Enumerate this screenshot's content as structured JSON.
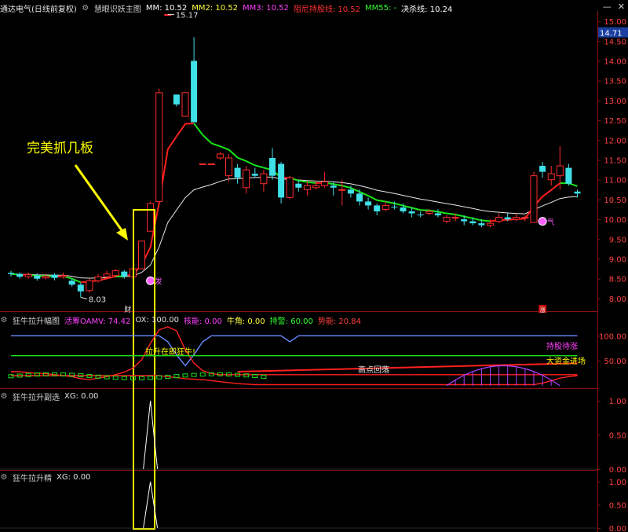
{
  "colors": {
    "bg": "#000000",
    "axis": "#8a1010",
    "up": "#ff2b2b",
    "down": "#3fe0e8",
    "ma_red": "#ff2020",
    "ma_green": "#19e619",
    "ma_white": "#e8e8e8",
    "annotation": "#ffff00",
    "magenta": "#ff40ff",
    "purple": "#b040ff",
    "blue_line": "#6a8cff"
  },
  "main_panel": {
    "title": "通达电气(日线前复权)",
    "indicator": "慧眼识妖主图",
    "mm_label": "MM: 10.52",
    "mm2_label": "MM2: 10.52",
    "mm3_label": "MM3: 10.52",
    "hold_label": "阻尼持股线: 10.52",
    "mm55_label": "MM55: -",
    "decision_label": "决杀线: 10.24",
    "current_price": "14.71",
    "high_label": "15.17",
    "low_label": "8.03",
    "annotation_text": "完美抓几板",
    "marker_fa": "发",
    "marker_qi": "气",
    "marker_cai": "财",
    "marker_zhang": "涨"
  },
  "sub1": {
    "title": "狂牛拉升幅图",
    "oamv_label": "活筹OAMV: 74.42",
    "ox_label": "OX: 100.00",
    "power_label": "核能: 0.00",
    "bull_label": "牛角: 0.00",
    "hold_label": "持警: 60.00",
    "momentum_label": "势能: 20.84",
    "text_launch": "拉升在即狂牛!",
    "text_high": "高点回落",
    "text_hold": "持股待涨",
    "text_capital": "大资金进场"
  },
  "sub2": {
    "title": "狂牛拉升副选",
    "xg_label": "XG: 0.00"
  },
  "sub3": {
    "title": "狂牛拉升精",
    "xg_label": "XG: 0.00"
  },
  "window_controls": [
    "—",
    "✕"
  ],
  "chart_data": [
    {
      "type": "candlestick",
      "title": "通达电气(日线前复权)",
      "y_ticks": [
        8.0,
        8.5,
        9.0,
        9.5,
        10.0,
        10.5,
        11.0,
        11.5,
        12.0,
        12.5,
        13.0,
        13.5,
        14.0,
        14.5,
        15.0
      ],
      "ylim": [
        7.72,
        15.22
      ],
      "candles": [
        [
          8.65,
          8.62,
          8.7,
          8.55
        ],
        [
          8.62,
          8.55,
          8.66,
          8.5
        ],
        [
          8.55,
          8.6,
          8.66,
          8.5
        ],
        [
          8.58,
          8.5,
          8.64,
          8.45
        ],
        [
          8.52,
          8.56,
          8.62,
          8.48
        ],
        [
          8.6,
          8.52,
          8.64,
          8.46
        ],
        [
          8.55,
          8.58,
          8.66,
          8.5
        ],
        [
          8.45,
          8.35,
          8.5,
          8.3
        ],
        [
          8.35,
          8.18,
          8.4,
          8.03
        ],
        [
          8.2,
          8.45,
          8.5,
          8.15
        ],
        [
          8.45,
          8.55,
          8.62,
          8.4
        ],
        [
          8.55,
          8.62,
          8.7,
          8.5
        ],
        [
          8.58,
          8.7,
          8.75,
          8.55
        ],
        [
          8.68,
          8.55,
          8.72,
          8.5
        ],
        [
          8.55,
          8.75,
          8.8,
          8.5
        ],
        [
          8.75,
          9.45,
          9.45,
          8.75
        ],
        [
          9.7,
          10.4,
          10.45,
          9.7
        ],
        [
          10.45,
          13.2,
          13.3,
          10.45
        ],
        [
          15.17,
          15.17,
          15.17,
          15.17
        ],
        [
          13.15,
          12.9,
          13.15,
          12.85
        ],
        [
          12.6,
          13.2,
          13.2,
          12.6
        ],
        [
          14.0,
          12.45,
          14.6,
          12.45
        ],
        [
          11.4,
          11.4,
          11.4,
          11.4
        ],
        [
          11.4,
          11.4,
          11.4,
          11.4
        ],
        [
          11.55,
          11.65,
          11.7,
          11.5
        ],
        [
          11.1,
          11.55,
          11.65,
          10.95
        ],
        [
          11.3,
          11.05,
          11.4,
          10.9
        ],
        [
          10.8,
          11.25,
          11.35,
          10.65
        ],
        [
          11.15,
          11.1,
          11.3,
          11.05
        ],
        [
          10.9,
          11.15,
          11.25,
          10.7
        ],
        [
          11.55,
          11.1,
          11.8,
          11.0
        ],
        [
          11.4,
          10.55,
          11.45,
          10.4
        ],
        [
          10.55,
          11.05,
          11.1,
          10.5
        ],
        [
          10.9,
          10.8,
          11.0,
          10.7
        ],
        [
          10.75,
          10.85,
          10.95,
          10.6
        ],
        [
          10.8,
          10.85,
          10.95,
          10.75
        ],
        [
          10.85,
          10.95,
          11.2,
          10.8
        ],
        [
          10.85,
          10.8,
          10.95,
          10.6
        ],
        [
          10.75,
          10.75,
          11.0,
          10.35
        ],
        [
          10.75,
          10.65,
          10.85,
          10.55
        ],
        [
          10.65,
          10.45,
          10.75,
          10.35
        ],
        [
          10.45,
          10.35,
          10.55,
          10.25
        ],
        [
          10.35,
          10.2,
          10.4,
          10.1
        ],
        [
          10.25,
          10.35,
          10.45,
          10.2
        ],
        [
          10.32,
          10.3,
          10.45,
          10.25
        ],
        [
          10.3,
          10.2,
          10.4,
          10.15
        ],
        [
          10.2,
          10.15,
          10.3,
          10.05
        ],
        [
          10.12,
          10.1,
          10.2,
          10.05
        ],
        [
          10.15,
          10.2,
          10.25,
          10.1
        ],
        [
          10.15,
          10.1,
          10.25,
          10.05
        ],
        [
          9.95,
          10.05,
          10.1,
          9.9
        ],
        [
          10.05,
          10.05,
          10.15,
          9.95
        ],
        [
          10.0,
          9.95,
          10.1,
          9.85
        ],
        [
          9.95,
          9.9,
          10.05,
          9.85
        ],
        [
          9.9,
          9.85,
          10.0,
          9.8
        ],
        [
          9.85,
          9.9,
          10.0,
          9.8
        ],
        [
          9.95,
          10.05,
          10.15,
          9.9
        ],
        [
          10.05,
          10.0,
          10.15,
          9.95
        ],
        [
          10.0,
          10.05,
          10.15,
          9.95
        ],
        [
          10.05,
          10.05,
          10.1,
          9.95
        ],
        [
          9.92,
          11.1,
          11.2,
          9.92
        ],
        [
          11.35,
          11.2,
          11.45,
          11.05
        ],
        [
          11.0,
          11.15,
          11.35,
          10.85
        ],
        [
          11.1,
          11.35,
          11.85,
          10.75
        ],
        [
          11.3,
          10.9,
          11.4,
          10.85
        ],
        [
          10.7,
          10.65,
          10.75,
          10.55
        ]
      ]
    },
    {
      "type": "line",
      "title": "狂牛拉升幅图",
      "y_ticks": [
        50.0,
        100.0
      ],
      "ylim": [
        -2,
        121
      ],
      "series": [
        {
          "name": "OX",
          "values": [
            100,
            100,
            100,
            100,
            100,
            100,
            100,
            100,
            100,
            100,
            100,
            100,
            100,
            100,
            100,
            100,
            100,
            100,
            88,
            62,
            40,
            62,
            88,
            100,
            100,
            100,
            100,
            100,
            100,
            100,
            100,
            100,
            88,
            100,
            100,
            100,
            100,
            100,
            100,
            100,
            100,
            100,
            100,
            100,
            100,
            100,
            100,
            100,
            100,
            100,
            100,
            100,
            100,
            100,
            100,
            100,
            100,
            100,
            100,
            100,
            100,
            100,
            100,
            100,
            100,
            100
          ]
        },
        {
          "name": "活筹OAMV",
          "values": [
            28,
            28,
            26,
            25,
            24,
            22,
            20,
            18,
            14,
            12,
            15,
            18,
            22,
            27,
            35,
            52,
            85,
            112,
            118,
            110,
            72,
            45,
            30,
            24,
            22,
            22,
            22,
            22,
            22,
            22,
            22,
            22,
            22,
            22,
            22,
            22,
            22,
            22,
            22,
            22,
            22,
            22,
            22,
            22,
            22,
            22,
            22,
            22,
            22,
            22,
            22,
            22,
            22,
            22,
            22,
            22,
            22,
            22,
            22,
            22,
            22,
            22,
            22,
            22,
            22,
            22
          ]
        },
        {
          "name": "持警",
          "values": [
            60,
            60,
            60,
            60,
            60,
            60,
            60,
            60,
            60,
            60,
            60,
            60,
            60,
            60,
            60,
            60,
            60,
            60,
            60,
            60,
            60,
            60,
            60,
            60,
            60,
            60,
            60,
            60,
            60,
            60,
            60,
            60,
            60,
            60,
            60,
            60,
            60,
            60,
            60,
            60,
            60,
            60,
            60,
            60,
            60,
            60,
            60,
            60,
            60,
            60,
            60,
            60,
            60,
            60,
            60,
            60,
            60,
            60,
            60,
            60,
            60,
            60,
            60,
            60,
            60,
            60
          ]
        },
        {
          "name": "势能",
          "values": [
            20,
            20,
            20,
            20,
            20,
            20,
            20,
            20,
            20,
            20,
            20,
            20,
            20,
            20,
            20,
            20,
            20,
            20,
            18,
            16,
            14,
            13,
            12,
            10,
            8,
            6,
            4,
            3,
            2,
            2,
            2,
            2,
            2,
            2,
            2,
            2,
            2,
            2,
            2,
            2,
            2,
            2,
            2,
            2,
            2,
            2,
            2,
            2,
            2,
            2,
            2,
            2,
            2,
            2,
            2,
            2,
            2,
            2,
            2,
            2,
            2,
            5,
            10,
            15,
            18,
            20
          ]
        }
      ]
    },
    {
      "type": "line",
      "title": "狂牛拉升副选",
      "y_ticks": [
        0.0,
        0.5,
        1.0
      ],
      "series": [
        {
          "name": "XG",
          "values": [
            0,
            0,
            0,
            0,
            0,
            0,
            0,
            0,
            0,
            0,
            0,
            0,
            0,
            0,
            0,
            0,
            1,
            0,
            0,
            0,
            0,
            0,
            0,
            0,
            0,
            0,
            0,
            0,
            0,
            0,
            0,
            0,
            0,
            0,
            0,
            0,
            0,
            0,
            0,
            0,
            0,
            0,
            0,
            0,
            0,
            0,
            0,
            0,
            0,
            0,
            0,
            0,
            0,
            0,
            0,
            0,
            0,
            0,
            0,
            0,
            0,
            0,
            0,
            0,
            0,
            0
          ]
        }
      ]
    },
    {
      "type": "line",
      "title": "狂牛拉升精",
      "y_ticks": [
        0.0,
        0.5,
        1.0
      ],
      "series": [
        {
          "name": "XG",
          "values": [
            0,
            0,
            0,
            0,
            0,
            0,
            0,
            0,
            0,
            0,
            0,
            0,
            0,
            0,
            0,
            0,
            1,
            0,
            0,
            0,
            0,
            0,
            0,
            0,
            0,
            0,
            0,
            0,
            0,
            0,
            0,
            0,
            0,
            0,
            0,
            0,
            0,
            0,
            0,
            0,
            0,
            0,
            0,
            0,
            0,
            0,
            0,
            0,
            0,
            0,
            0,
            0,
            0,
            0,
            0,
            0,
            0,
            0,
            0,
            0,
            0,
            0,
            0,
            0,
            0,
            0
          ]
        }
      ]
    }
  ]
}
